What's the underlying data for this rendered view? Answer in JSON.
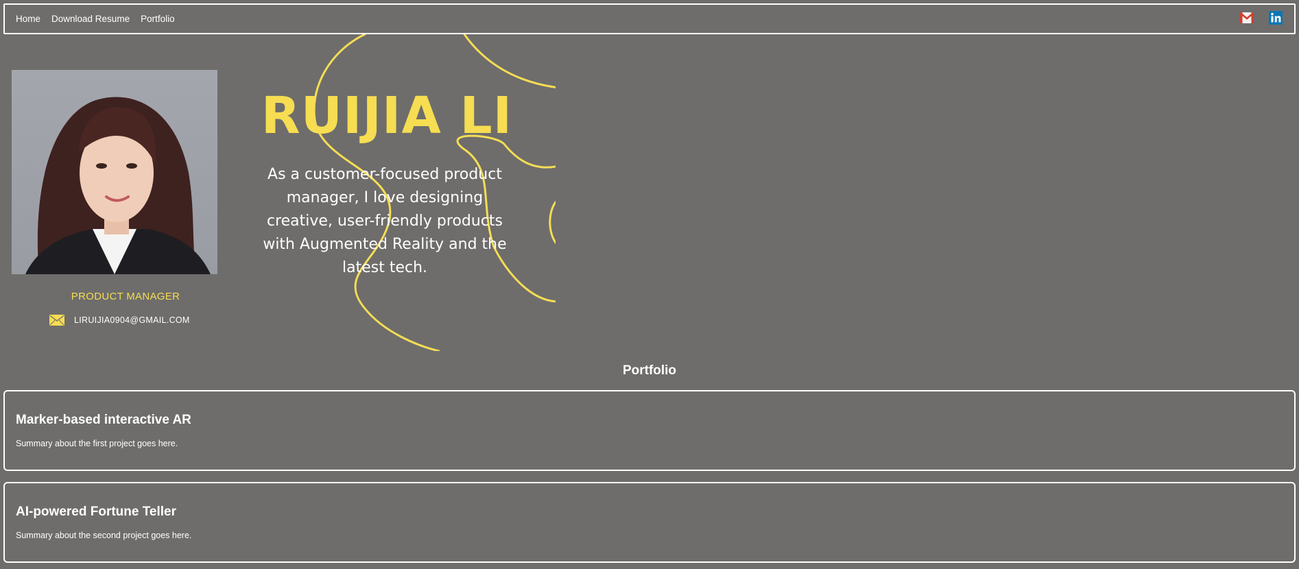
{
  "nav": {
    "links": [
      "Home",
      "Download Resume",
      "Portfolio"
    ],
    "icons": [
      "gmail-icon",
      "linkedin-icon"
    ]
  },
  "profile": {
    "role": "PRODUCT MANAGER",
    "email": "LIRUIJIA0904@GMAIL.COM"
  },
  "hero": {
    "name": "RUIJIA LI",
    "tagline": "As a customer-focused product manager, I love designing creative, user-friendly products with Augmented Reality and the latest tech."
  },
  "portfolio": {
    "title": "Portfolio",
    "projects": [
      {
        "title": "Marker-based interactive AR",
        "summary": "Summary about the first project goes here."
      },
      {
        "title": "AI-powered Fortune Teller",
        "summary": "Summary about the second project goes here."
      }
    ]
  },
  "colors": {
    "background": "#6e6d6b",
    "accent": "#f6dd52",
    "text": "#ffffff",
    "border": "#ffffff"
  }
}
